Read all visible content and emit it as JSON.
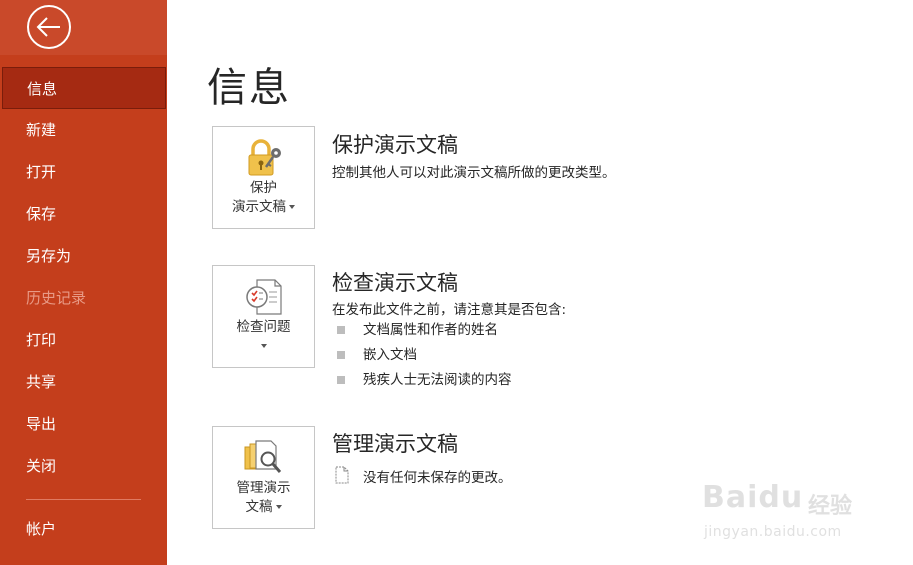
{
  "sidebar": {
    "items": [
      {
        "label": "信息"
      },
      {
        "label": "新建"
      },
      {
        "label": "打开"
      },
      {
        "label": "保存"
      },
      {
        "label": "另存为"
      },
      {
        "label": "历史记录"
      },
      {
        "label": "打印"
      },
      {
        "label": "共享"
      },
      {
        "label": "导出"
      },
      {
        "label": "关闭"
      },
      {
        "label": "帐户"
      }
    ]
  },
  "page_title": "信息",
  "sections": {
    "protect": {
      "button_line1": "保护",
      "button_line2": "演示文稿",
      "title": "保护演示文稿",
      "description": "控制其他人可以对此演示文稿所做的更改类型。"
    },
    "inspect": {
      "button_line1": "检查问题",
      "title": "检查演示文稿",
      "description": "在发布此文件之前，请注意其是否包含:",
      "bullets": [
        "文档属性和作者的姓名",
        "嵌入文档",
        "残疾人士无法阅读的内容"
      ]
    },
    "manage": {
      "button_line1": "管理演示",
      "button_line2": "文稿",
      "title": "管理演示文稿",
      "description": "没有任何未保存的更改。"
    }
  },
  "watermark": {
    "brand": "Baidu",
    "suffix": "经验",
    "url": "jingyan.baidu.com"
  },
  "colors": {
    "sidebar": "#c43e1c",
    "sidebar_active": "#a52a12",
    "lock_gold": "#e8b23a"
  }
}
